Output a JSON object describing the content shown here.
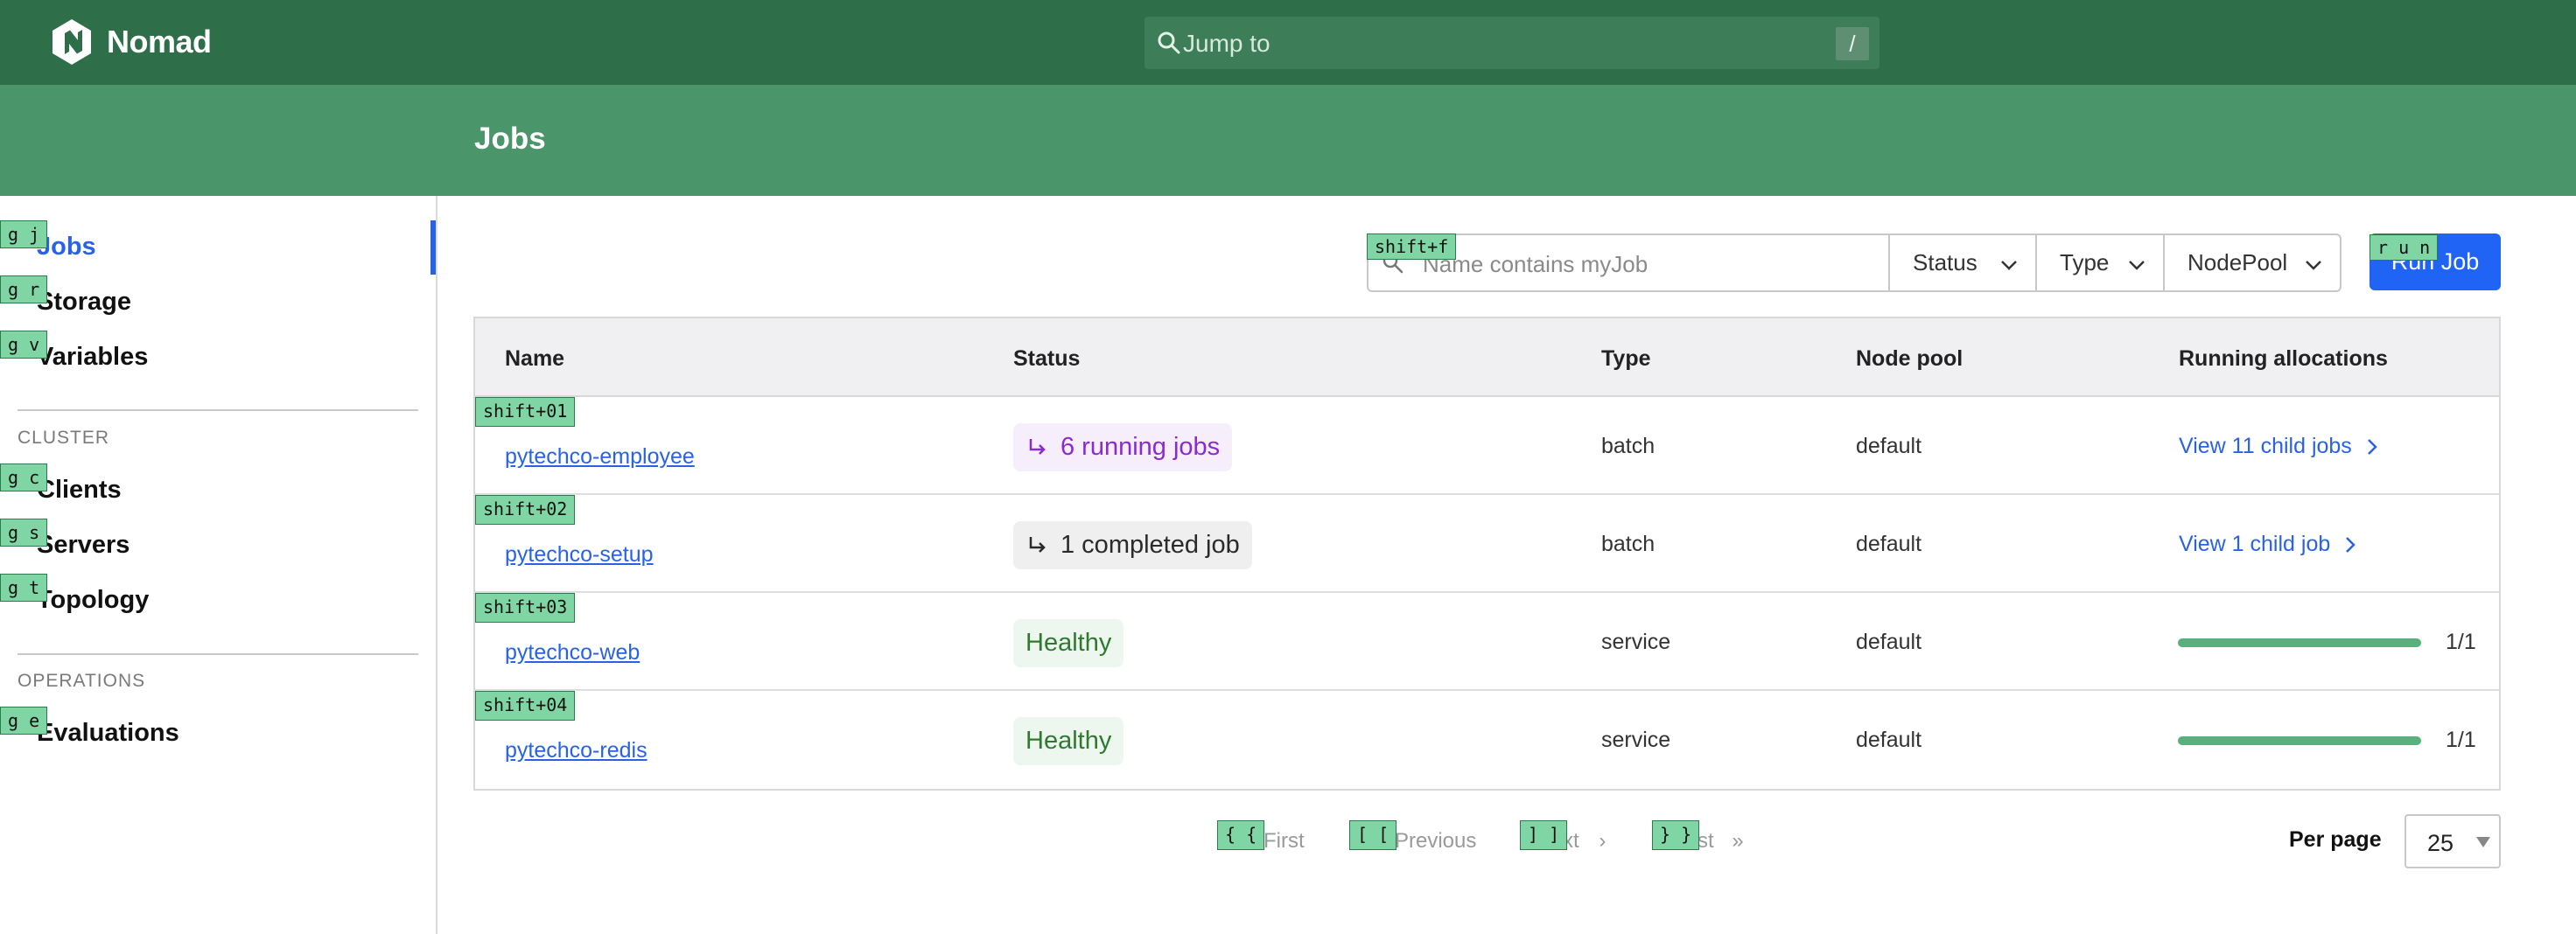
{
  "app": {
    "name": "Nomad"
  },
  "search": {
    "placeholder": "Jump to",
    "shortcut": "/"
  },
  "page": {
    "title": "Jobs"
  },
  "sidebar": {
    "items": [
      {
        "label": "Jobs",
        "key": "g j",
        "active": true
      },
      {
        "label": "Storage",
        "key": "g r"
      },
      {
        "label": "Variables",
        "key": "g v"
      }
    ],
    "cluster_label": "CLUSTER",
    "cluster_items": [
      {
        "label": "Clients",
        "key": "g c"
      },
      {
        "label": "Servers",
        "key": "g s"
      },
      {
        "label": "Topology",
        "key": "g t"
      }
    ],
    "operations_label": "OPERATIONS",
    "operations_items": [
      {
        "label": "Evaluations",
        "key": "g e"
      }
    ]
  },
  "filters": {
    "search_placeholder": "Name contains myJob",
    "search_key": "shift+f",
    "status": "Status",
    "type": "Type",
    "nodepool": "NodePool",
    "run_label": "Run Job",
    "run_key": "r u n"
  },
  "table": {
    "headers": [
      "Name",
      "Status",
      "Type",
      "Node pool",
      "Running allocations"
    ],
    "rows": [
      {
        "key": "shift+01",
        "name": "pytechco-employee",
        "status": "6 running jobs",
        "type": "batch",
        "node_pool": "default",
        "allocations": "View 11 child jobs"
      },
      {
        "key": "shift+02",
        "name": "pytechco-setup",
        "status": "1 completed job",
        "type": "batch",
        "node_pool": "default",
        "allocations": "View 1 child job"
      },
      {
        "key": "shift+03",
        "name": "pytechco-web",
        "status": "Healthy",
        "type": "service",
        "node_pool": "default",
        "allocations": "1/1",
        "progress": 1.0
      },
      {
        "key": "shift+04",
        "name": "pytechco-redis",
        "status": "Healthy",
        "type": "service",
        "node_pool": "default",
        "allocations": "1/1",
        "progress": 1.0
      }
    ]
  },
  "pagination": {
    "first": "First",
    "first_key": "{ {",
    "previous": "Previous",
    "previous_key": "[ [",
    "next": "xt",
    "next_key": "] ]",
    "last": "st",
    "last_key": "} }",
    "per_page_label": "Per page",
    "per_page_value": "25"
  },
  "colors": {
    "topbar": "#2e6f4a",
    "header": "#4a956a",
    "accent": "#2a62e6",
    "running": "#8a2bd0",
    "healthy": "#2f7a2f"
  }
}
